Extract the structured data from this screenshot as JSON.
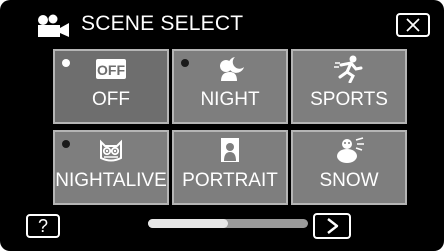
{
  "header": {
    "title": "SCENE SELECT",
    "camera_icon": "movie-camera-icon",
    "close_icon": "close-icon"
  },
  "tiles": [
    {
      "label": "OFF",
      "icon_text": "OFF",
      "icon": "off-icon",
      "selected": true
    },
    {
      "label": "NIGHT",
      "icon": "moon-person-icon",
      "selected": false
    },
    {
      "label": "SPORTS",
      "icon": "running-person-icon",
      "selected": false
    },
    {
      "label": "NIGHTALIVE",
      "icon": "owl-icon",
      "selected": false
    },
    {
      "label": "PORTRAIT",
      "icon": "portrait-icon",
      "selected": false
    },
    {
      "label": "SNOW",
      "icon": "snowman-icon",
      "selected": false
    }
  ],
  "footer": {
    "help_label": "?",
    "next_icon": "chevron-right-icon",
    "scroll_position": 0.5
  },
  "colors": {
    "tile_bg": "#7e7e7e",
    "tile_border": "#b5b5b5",
    "screen_bg": "#000000"
  }
}
